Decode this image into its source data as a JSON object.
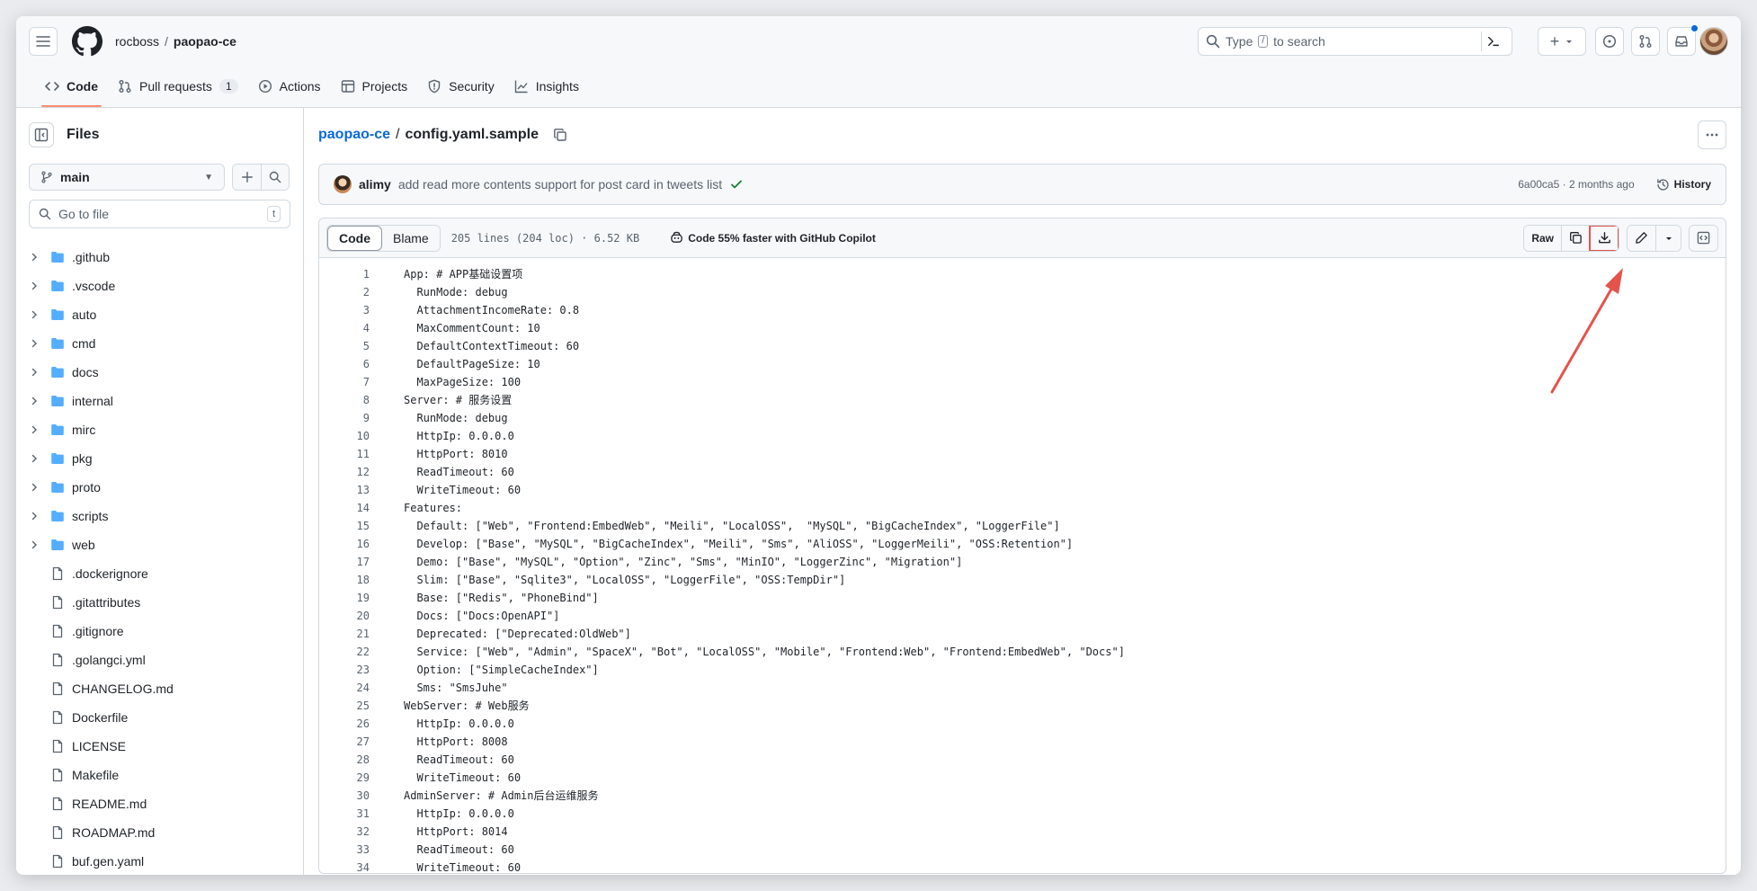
{
  "header": {
    "owner": "rocboss",
    "separator": "/",
    "repo": "paopao-ce",
    "search_prefix": "Type",
    "search_key": "/",
    "search_suffix": "to search",
    "plus_label": "+"
  },
  "tabs": [
    {
      "label": "Code",
      "icon": "code-icon"
    },
    {
      "label": "Pull requests",
      "icon": "pull-request-icon",
      "count": "1"
    },
    {
      "label": "Actions",
      "icon": "play-icon"
    },
    {
      "label": "Projects",
      "icon": "table-icon"
    },
    {
      "label": "Security",
      "icon": "shield-icon"
    },
    {
      "label": "Insights",
      "icon": "graph-icon"
    }
  ],
  "sidebar": {
    "title": "Files",
    "branch": "main",
    "goto_placeholder": "Go to file",
    "goto_key": "t",
    "folders": [
      ".github",
      ".vscode",
      "auto",
      "cmd",
      "docs",
      "internal",
      "mirc",
      "pkg",
      "proto",
      "scripts",
      "web"
    ],
    "files": [
      ".dockerignore",
      ".gitattributes",
      ".gitignore",
      ".golangci.yml",
      "CHANGELOG.md",
      "Dockerfile",
      "LICENSE",
      "Makefile",
      "README.md",
      "ROADMAP.md",
      "buf.gen.yaml"
    ]
  },
  "file": {
    "repo": "paopao-ce",
    "separator": "/",
    "name": "config.yaml.sample"
  },
  "commit": {
    "author": "alimy",
    "message": "add read more contents support for post card in tweets list",
    "meta": "6a00ca5 · 2 months ago",
    "history_label": "History"
  },
  "toolbar": {
    "code_label": "Code",
    "blame_label": "Blame",
    "info": "205 lines (204 loc) · 6.52 KB",
    "copilot": "Code 55% faster with GitHub Copilot",
    "raw_label": "Raw"
  },
  "code_lines": [
    "App: # APP基础设置项",
    "  RunMode: debug",
    "  AttachmentIncomeRate: 0.8",
    "  MaxCommentCount: 10",
    "  DefaultContextTimeout: 60",
    "  DefaultPageSize: 10",
    "  MaxPageSize: 100",
    "Server: # 服务设置",
    "  RunMode: debug",
    "  HttpIp: 0.0.0.0",
    "  HttpPort: 8010",
    "  ReadTimeout: 60",
    "  WriteTimeout: 60",
    "Features:",
    "  Default: [\"Web\", \"Frontend:EmbedWeb\", \"Meili\", \"LocalOSS\",  \"MySQL\", \"BigCacheIndex\", \"LoggerFile\"]",
    "  Develop: [\"Base\", \"MySQL\", \"BigCacheIndex\", \"Meili\", \"Sms\", \"AliOSS\", \"LoggerMeili\", \"OSS:Retention\"]",
    "  Demo: [\"Base\", \"MySQL\", \"Option\", \"Zinc\", \"Sms\", \"MinIO\", \"LoggerZinc\", \"Migration\"]",
    "  Slim: [\"Base\", \"Sqlite3\", \"LocalOSS\", \"LoggerFile\", \"OSS:TempDir\"]",
    "  Base: [\"Redis\", \"PhoneBind\"]",
    "  Docs: [\"Docs:OpenAPI\"]",
    "  Deprecated: [\"Deprecated:OldWeb\"]",
    "  Service: [\"Web\", \"Admin\", \"SpaceX\", \"Bot\", \"LocalOSS\", \"Mobile\", \"Frontend:Web\", \"Frontend:EmbedWeb\", \"Docs\"]",
    "  Option: [\"SimpleCacheIndex\"]",
    "  Sms: \"SmsJuhe\"",
    "WebServer: # Web服务",
    "  HttpIp: 0.0.0.0",
    "  HttpPort: 8008",
    "  ReadTimeout: 60",
    "  WriteTimeout: 60",
    "AdminServer: # Admin后台运维服务",
    "  HttpIp: 0.0.0.0",
    "  HttpPort: 8014",
    "  ReadTimeout: 60",
    "  WriteTimeout: 60"
  ],
  "colors": {
    "accent": "#0969da",
    "tab_underline": "#fd8c73",
    "folder": "#54aeff",
    "annotation": "#e5534b",
    "success": "#1a7f37"
  }
}
